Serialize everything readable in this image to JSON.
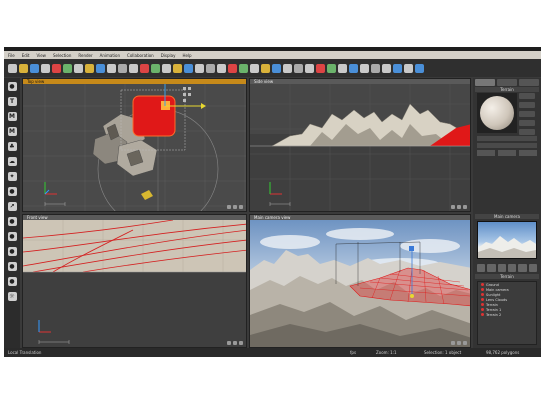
{
  "menu": {
    "items": [
      "File",
      "Edit",
      "View",
      "Selection",
      "Render",
      "Animation",
      "Collaboration",
      "Display",
      "Help"
    ]
  },
  "toolbar": {
    "button_colors": [
      "#c9c9c9",
      "#d9b23a",
      "#4a8fd8",
      "#c9c9c9",
      "#d44",
      "#6bb36b",
      "#c9c9c9",
      "#d9b23a",
      "#4a8fd8",
      "#c9c9c9",
      "#aaa",
      "#c9c9c9",
      "#d44",
      "#6bb36b",
      "#c9c9c9",
      "#d9b23a",
      "#4a8fd8",
      "#c9c9c9",
      "#aaa",
      "#c9c9c9",
      "#d44",
      "#6bb36b",
      "#c9c9c9",
      "#d9b23a",
      "#4a8fd8",
      "#c9c9c9",
      "#aaa",
      "#c9c9c9",
      "#d44",
      "#6bb36b",
      "#c9c9c9",
      "#4a8fd8",
      "#c9c9c9",
      "#aaa",
      "#c9c9c9",
      "#4a8fd8",
      "#c9c9c9",
      "#4a8fd8"
    ]
  },
  "left_tools": {
    "icons": [
      "sphere-icon",
      "text-tool-icon",
      "mountain-tool-icon",
      "terrain-tool-icon",
      "plant-tool-icon",
      "cloud-tool-icon",
      "light-tool-icon",
      "camera-tool-icon",
      "path-tool-icon",
      "group-tool-icon",
      "boolean-tool-icon",
      "metablob-tool-icon",
      "python-tool-icon",
      "settings-tool-icon",
      "render-tool-icon"
    ],
    "glyphs": [
      "●",
      "T",
      "M",
      "M",
      "♣",
      "☁",
      "✦",
      "●",
      "↗",
      "●",
      "●",
      "●",
      "●",
      "●",
      "☼"
    ]
  },
  "viewports": {
    "top": {
      "title": "Top view"
    },
    "side": {
      "title": "Side view"
    },
    "front": {
      "title": "Front view"
    },
    "main": {
      "title": "Main camera view"
    }
  },
  "right_panel": {
    "material_label": "Terrain",
    "camera_label": "Main camera",
    "tree_label": "Terrain",
    "tree_items": [
      "Ground",
      "Main camera",
      "Sunlight",
      "Lens Clouds",
      "Terrain",
      "Terrain 1",
      "Terrain 2"
    ]
  },
  "status": {
    "left": "Local Translation",
    "fps": "fps",
    "zoom": "Zoom: 1:1",
    "selection": "Selection: 1 object",
    "polygons": "98,762 polygons"
  },
  "colors": {
    "accent": "#c78a1a",
    "selection": "#e01818",
    "terrain_wire": "#e02020"
  }
}
